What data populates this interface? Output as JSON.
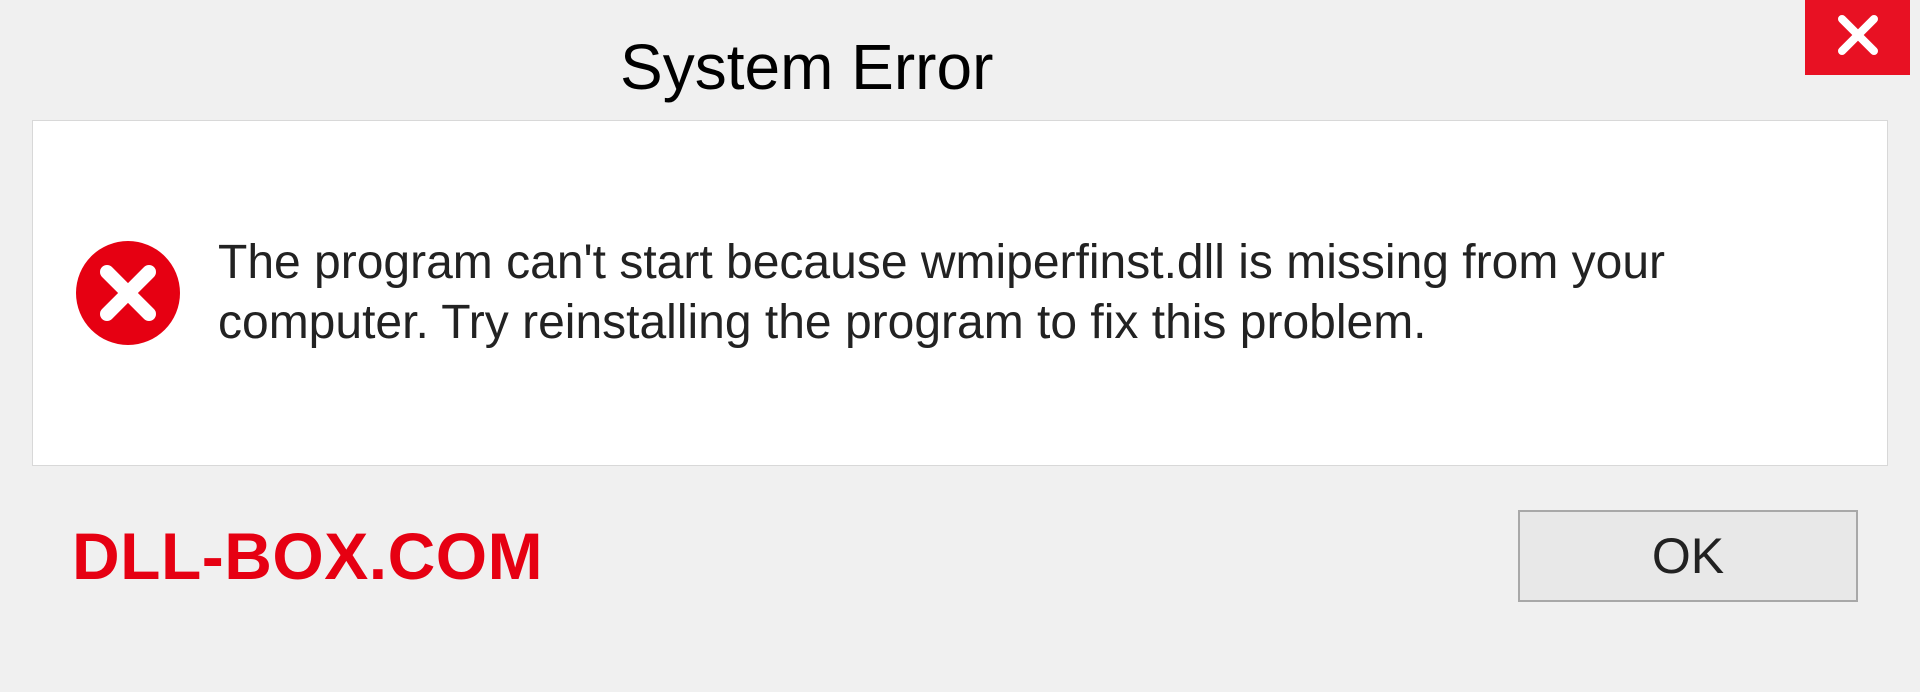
{
  "titlebar": {
    "title": "System Error"
  },
  "dialog": {
    "message": "The program can't start because wmiperfinst.dll is missing from your computer. Try reinstalling the program to fix this problem."
  },
  "footer": {
    "watermark": "DLL-BOX.COM",
    "ok_label": "OK"
  }
}
